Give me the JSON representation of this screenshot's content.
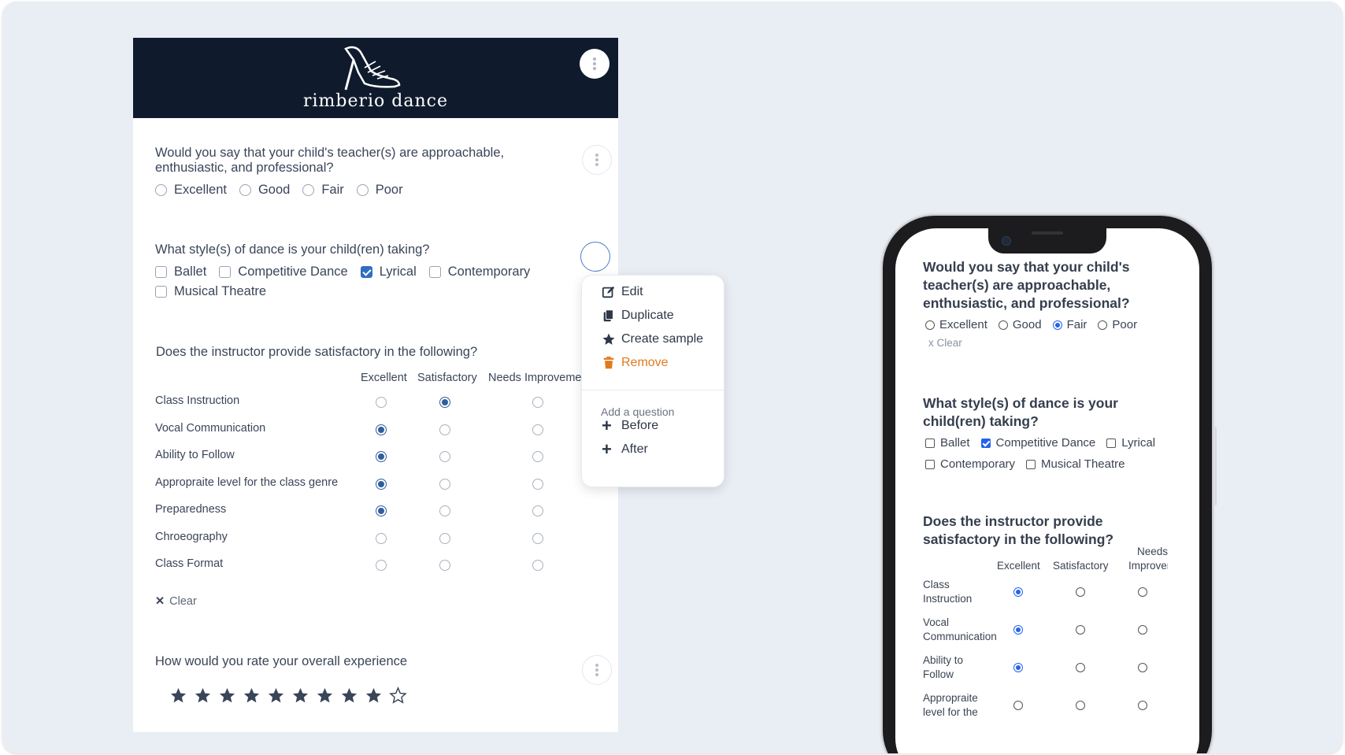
{
  "brand": {
    "name": "rimberio dance",
    "header_bg": "#0f1b2d"
  },
  "colors": {
    "accent": "#2f6ec2",
    "remove": "#e07a1e"
  },
  "form": {
    "q1": {
      "text": "Would you say that your child's teacher(s) are approachable, enthusiastic, and professional?",
      "options": [
        "Excellent",
        "Good",
        "Fair",
        "Poor"
      ]
    },
    "q2": {
      "text": "What style(s) of dance is your child(ren) taking?",
      "options": [
        "Ballet",
        "Competitive Dance",
        "Lyrical",
        "Contemporary",
        "Musical Theatre"
      ],
      "checked": [
        "Lyrical"
      ]
    },
    "q3": {
      "text": "Does the instructor provide satisfactory in the following?",
      "columns": [
        "Excellent",
        "Satisfactory",
        "Needs Improveme"
      ],
      "rows": [
        {
          "label": "Class Instruction",
          "selected": "Satisfactory"
        },
        {
          "label": "Vocal Communication",
          "selected": "Excellent"
        },
        {
          "label": "Ability to Follow",
          "selected": "Excellent"
        },
        {
          "label": "Appropraite level for the class genre",
          "selected": "Excellent"
        },
        {
          "label": "Preparedness",
          "selected": "Excellent"
        },
        {
          "label": "Chroeography",
          "selected": ""
        },
        {
          "label": "Class Format",
          "selected": ""
        }
      ],
      "clear_label": "Clear"
    },
    "q4": {
      "text": "How would you rate your overall experience",
      "rating": 9,
      "max": 10
    }
  },
  "menu": {
    "edit": "Edit",
    "duplicate": "Duplicate",
    "create_sample": "Create sample",
    "remove": "Remove",
    "add_label": "Add a question",
    "before": "Before",
    "after": "After"
  },
  "phone": {
    "q1": {
      "text": "Would you say that your child's teacher(s) are approachable, enthusiastic, and professional?",
      "options": [
        "Excellent",
        "Good",
        "Fair",
        "Poor"
      ],
      "selected": "Fair",
      "clear": "x Clear"
    },
    "q2": {
      "text": "What style(s) of dance is your child(ren) taking?",
      "options": [
        "Ballet",
        "Competitive Dance",
        "Lyrical",
        "Contemporary",
        "Musical Theatre"
      ],
      "checked": [
        "Competitive Dance"
      ]
    },
    "q3": {
      "text": "Does the instructor provide satisfactory in the following?",
      "columns": [
        "Excellent",
        "Satisfactory",
        "Needs Improvem"
      ],
      "rows": [
        "Class Instruction",
        "Vocal Communication",
        "Ability to Follow",
        "Appropraite level for the"
      ]
    }
  }
}
